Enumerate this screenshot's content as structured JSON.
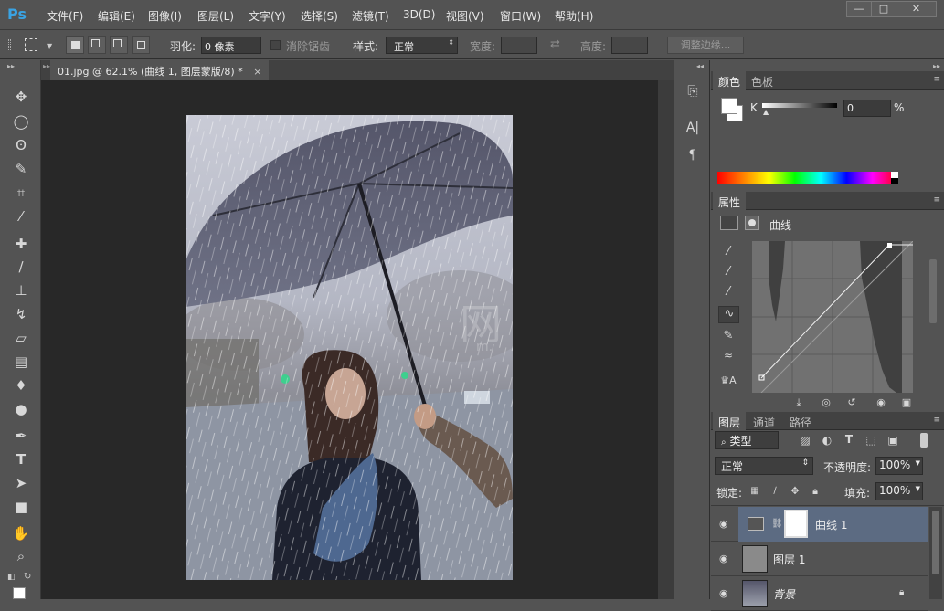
{
  "app": {
    "logo": "Ps"
  },
  "menu": [
    "文件(F)",
    "编辑(E)",
    "图像(I)",
    "图层(L)",
    "文字(Y)",
    "选择(S)",
    "滤镜(T)",
    "3D(D)",
    "视图(V)",
    "窗口(W)",
    "帮助(H)"
  ],
  "window_controls": {
    "minimize": "—",
    "maximize": "□",
    "close": "✕"
  },
  "options": {
    "feather_label": "羽化:",
    "feather_value": "0 像素",
    "antialias_label": "消除锯齿",
    "style_label": "样式:",
    "style_value": "正常",
    "width_label": "宽度:",
    "height_label": "高度:",
    "refine_edge": "调整边缘..."
  },
  "document": {
    "tab_title": "01.jpg @ 62.1% (曲线 1, 图层蒙版/8) *",
    "tab_close": "×"
  },
  "watermark": {
    "line1": "网",
    "line2": "m."
  },
  "color_panel": {
    "tabs": [
      "颜色",
      "色板"
    ],
    "channel": "K",
    "value": "0",
    "unit": "%"
  },
  "properties_panel": {
    "tab": "属性",
    "adjustment": "曲线"
  },
  "layers_panel": {
    "tabs": [
      "图层",
      "通道",
      "路径"
    ],
    "filter_kind": "类型",
    "blend_mode": "正常",
    "opacity_label": "不透明度:",
    "opacity_value": "100%",
    "lock_label": "锁定:",
    "fill_label": "填充:",
    "fill_value": "100%",
    "layers": [
      {
        "name": "曲线 1"
      },
      {
        "name": "图层 1"
      },
      {
        "name": "背景"
      }
    ]
  },
  "colors": {
    "accent": "#3aa3e3",
    "selected_layer": "#5c6b82"
  }
}
